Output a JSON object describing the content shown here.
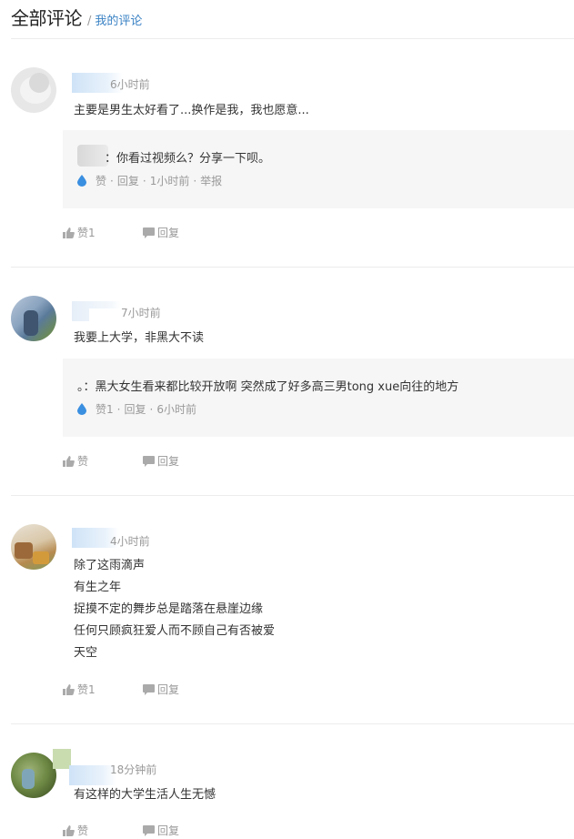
{
  "header": {
    "title": "全部评论",
    "separator": "/",
    "my_comments": "我的评论"
  },
  "comments": [
    {
      "time": "6小时前",
      "lines": [
        "主要是男生太好看了...换作是我，我也愿意..."
      ],
      "reply": {
        "text": "：你看过视频么？分享一下呗。",
        "like": "赞",
        "dot1": "·",
        "reply": "回复",
        "dot2": "·",
        "time": "1小时前",
        "dot3": "·",
        "report": "举报"
      },
      "like_label": "赞1",
      "reply_label": "回复"
    },
    {
      "time": "7小时前",
      "lines": [
        "我要上大学，非黑大不读"
      ],
      "reply": {
        "text": "。：黑大女生看来都比较开放啊 突然成了好多高三男tong xue向往的地方",
        "like": "赞1",
        "dot1": "·",
        "reply": "回复",
        "dot2": "·",
        "time": "6小时前"
      },
      "like_label": "赞",
      "reply_label": "回复"
    },
    {
      "time": "4小时前",
      "lines": [
        "除了这雨滴声",
        "有生之年",
        "捉摸不定的舞步总是踏落在悬崖边缘",
        "任何只顾疯狂爱人而不顾自己有否被爱",
        "天空"
      ],
      "like_label": "赞1",
      "reply_label": "回复"
    },
    {
      "time": "18分钟前",
      "lines": [
        "有这样的大学生活人生无憾"
      ],
      "like_label": "赞",
      "reply_label": "回复"
    }
  ]
}
